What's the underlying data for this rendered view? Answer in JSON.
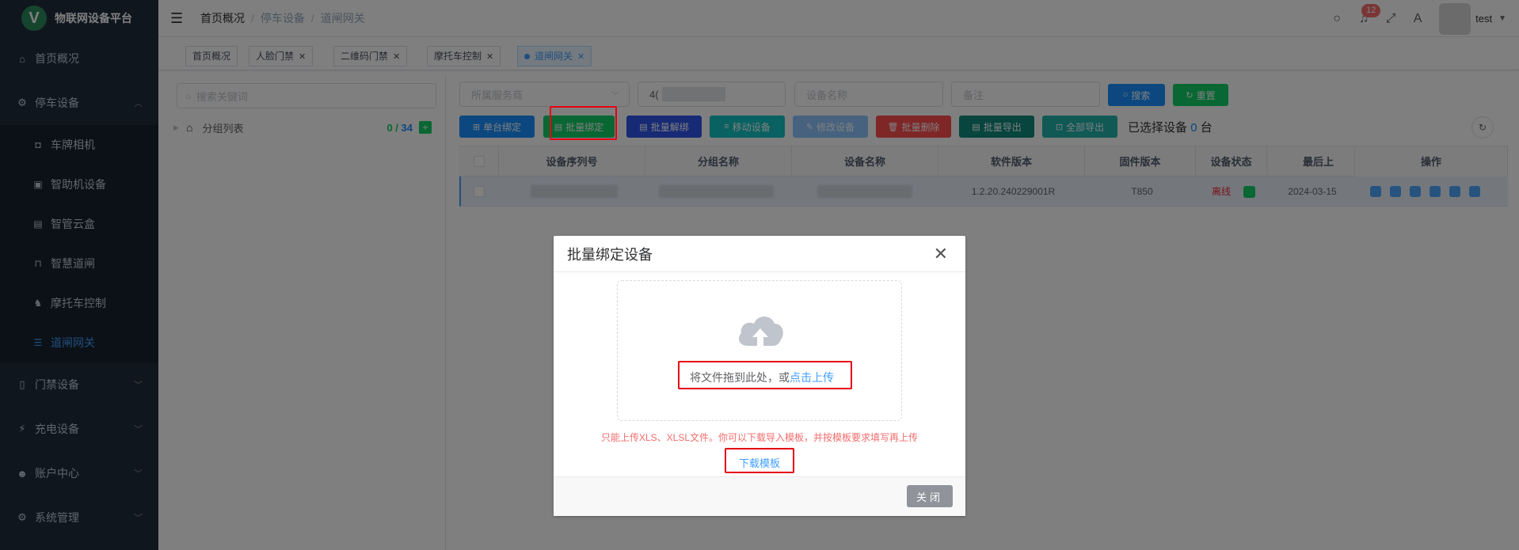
{
  "app": {
    "title": "物联网设备平台",
    "logo_letter": "V"
  },
  "sidebar": {
    "items": [
      {
        "label": "首页概况",
        "icon": "home-icon"
      },
      {
        "label": "停车设备",
        "icon": "parking-device-icon",
        "expanded": true
      },
      {
        "label": "门禁设备",
        "icon": "access-control-icon"
      },
      {
        "label": "充电设备",
        "icon": "charging-icon"
      },
      {
        "label": "账户中心",
        "icon": "user-icon"
      },
      {
        "label": "系统管理",
        "icon": "gear-icon"
      }
    ],
    "subitems": [
      {
        "label": "车牌相机",
        "icon": "camera-icon"
      },
      {
        "label": "智助机设备",
        "icon": "kiosk-icon"
      },
      {
        "label": "智管云盒",
        "icon": "cloud-box-icon"
      },
      {
        "label": "智慧道闸",
        "icon": "barrier-gate-icon"
      },
      {
        "label": "摩托车控制",
        "icon": "motorcycle-icon"
      },
      {
        "label": "道闸网关",
        "icon": "gateway-icon",
        "active": true
      }
    ]
  },
  "navbar": {
    "breadcrumb": [
      "首页概况",
      "停车设备",
      "道闸网关"
    ],
    "notifications": "12",
    "username": "test"
  },
  "tags": [
    {
      "label": "首页概况",
      "closable": false
    },
    {
      "label": "人脸门禁",
      "closable": true
    },
    {
      "label": "二维码门禁",
      "closable": true
    },
    {
      "label": "摩托车控制",
      "closable": true
    },
    {
      "label": "道闸网关",
      "closable": true,
      "active": true
    }
  ],
  "tree": {
    "search_placeholder": "搜索关键词",
    "root_label": "分组列表",
    "count_selected": "0",
    "count_sep": " / ",
    "count_total": "34"
  },
  "filters": {
    "service_provider_placeholder": "所属服务商",
    "serial_value": "4(",
    "device_name_placeholder": "设备名称",
    "remark_placeholder": "备注",
    "search_label": "搜索",
    "reset_label": "重置"
  },
  "toolbar": {
    "single_bind": "单台绑定",
    "batch_bind": "批量绑定",
    "batch_unbind": "批量解绑",
    "move_device": "移动设备",
    "edit_device": "修改设备",
    "batch_delete": "批量删除",
    "batch_export": "批量导出",
    "export_all": "全部导出",
    "selected_prefix": "已选择设备",
    "selected_count": "0",
    "selected_suffix": "台"
  },
  "table": {
    "columns": [
      "设备序列号",
      "分组名称",
      "设备名称",
      "软件版本",
      "固件版本",
      "设备状态",
      "最后上",
      "操作"
    ],
    "rows": [
      {
        "software": "1.2.20.240229001R",
        "firmware": "T850",
        "status": "离线",
        "last": "2024-03-15"
      }
    ]
  },
  "dialog": {
    "title": "批量绑定设备",
    "drop_text": "将文件拖到此处，或",
    "drop_link": "点击上传",
    "tip": "只能上传XLS、XLSL文件。你可以下载导入模板，并按模板要求填写再上传",
    "download_link": "下载模板",
    "close_label": "关闭"
  },
  "colors": {
    "sidebar_bg": "#1f2d3d",
    "accent": "#409eff",
    "highlight_border": "#e60012",
    "tip_red": "#f56c6c"
  }
}
